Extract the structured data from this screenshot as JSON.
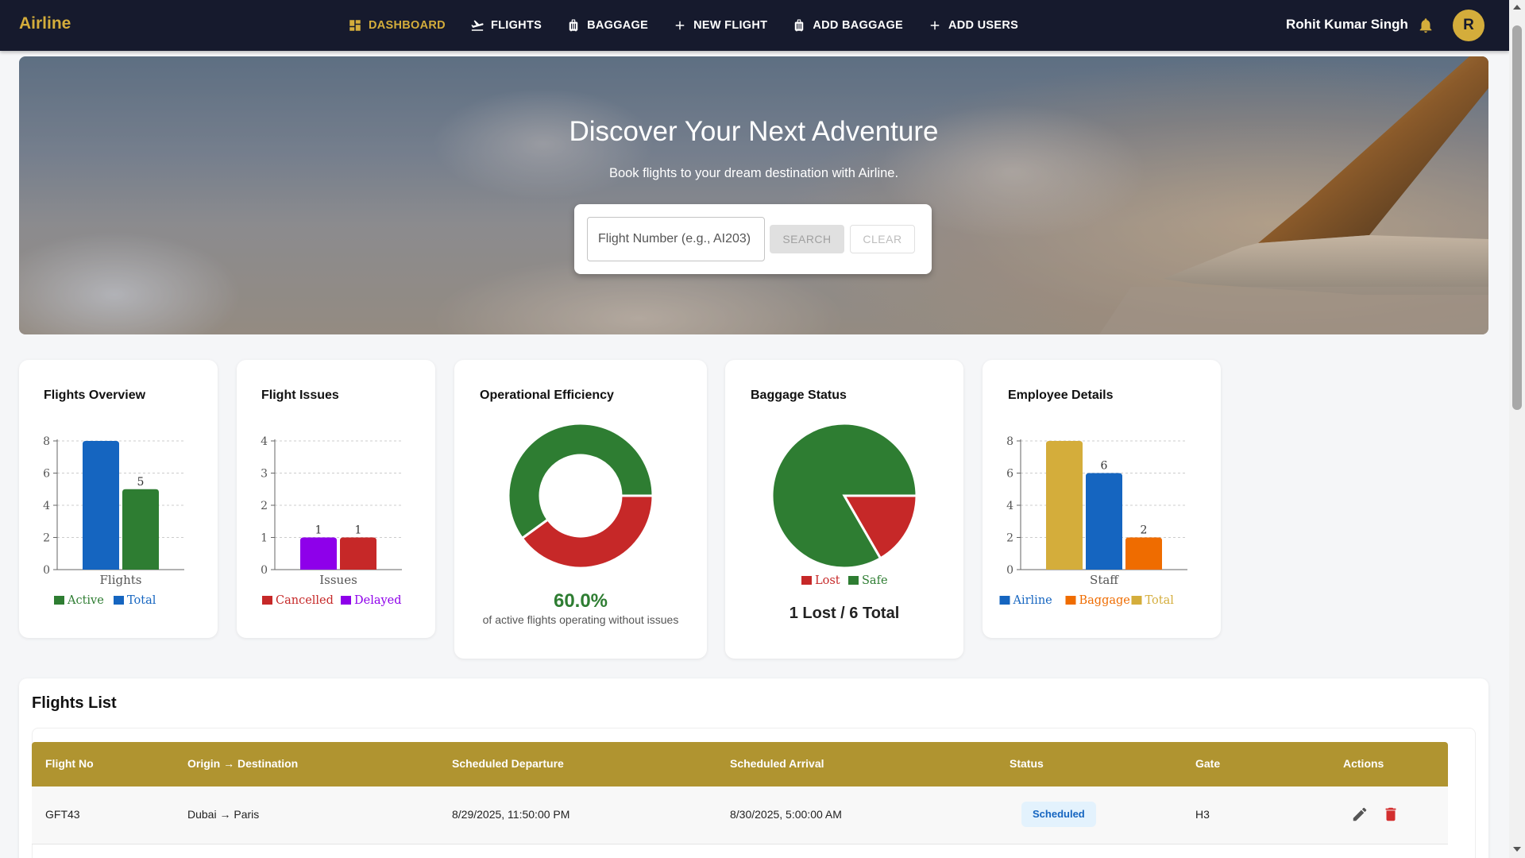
{
  "app": {
    "brand": "Airline"
  },
  "nav": {
    "items": [
      {
        "label": "DASHBOARD",
        "icon": "dashboard-icon",
        "active": true
      },
      {
        "label": "FLIGHTS",
        "icon": "flight-takeoff-icon"
      },
      {
        "label": "BAGGAGE",
        "icon": "luggage-icon"
      },
      {
        "label": "NEW FLIGHT",
        "icon": "plus-icon"
      },
      {
        "label": "ADD BAGGAGE",
        "icon": "luggage-icon"
      },
      {
        "label": "ADD USERS",
        "icon": "plus-icon"
      }
    ]
  },
  "user": {
    "name": "Rohit Kumar Singh",
    "avatar_initial": "R"
  },
  "colors": {
    "navbar": "#161a2d",
    "accent": "#d4ad3b",
    "table_header": "#b09430",
    "green": "#2e7d32",
    "red": "#c62828",
    "blue": "#1565c0",
    "purple": "#8e00ea",
    "orange": "#ef6c00"
  },
  "hero": {
    "title": "Discover Your Next Adventure",
    "subtitle": "Book flights to your dream destination with Airline.",
    "search_placeholder": "Flight Number (e.g., AI203)",
    "search_label": "SEARCH",
    "clear_label": "CLEAR"
  },
  "cards": {
    "flights_overview": {
      "title": "Flights Overview"
    },
    "flight_issues": {
      "title": "Flight Issues"
    },
    "operational_efficiency": {
      "title": "Operational Efficiency",
      "value": "60.0%",
      "subtitle": "of active flights operating without issues"
    },
    "baggage_status": {
      "title": "Baggage Status",
      "summary": "1 Lost / 6 Total"
    },
    "employee_details": {
      "title": "Employee Details"
    }
  },
  "chart_data": [
    {
      "id": "flights_overview",
      "type": "bar",
      "categories": [
        "Flights"
      ],
      "series": [
        {
          "name": "Total",
          "values": [
            8
          ],
          "color": "#1565c0"
        },
        {
          "name": "Active",
          "values": [
            5
          ],
          "color": "#2e7d32"
        }
      ],
      "data_labels": [
        "",
        "5"
      ],
      "ylim": [
        0,
        8
      ],
      "yticks": [
        0,
        2,
        4,
        6,
        8
      ],
      "legend": [
        {
          "name": "Active",
          "color": "#2e7d32"
        },
        {
          "name": "Total",
          "color": "#1565c0"
        }
      ]
    },
    {
      "id": "flight_issues",
      "type": "bar",
      "categories": [
        "Issues"
      ],
      "series": [
        {
          "name": "Delayed",
          "values": [
            1
          ],
          "color": "#8e00ea"
        },
        {
          "name": "Cancelled",
          "values": [
            1
          ],
          "color": "#c62828"
        }
      ],
      "data_labels": [
        "1",
        "1"
      ],
      "ylim": [
        0,
        4
      ],
      "yticks": [
        0,
        1,
        2,
        3,
        4
      ],
      "legend": [
        {
          "name": "Cancelled",
          "color": "#c62828"
        },
        {
          "name": "Delayed",
          "color": "#8e00ea"
        }
      ]
    },
    {
      "id": "operational_efficiency",
      "type": "pie",
      "donut": true,
      "slices": [
        {
          "name": "Operating without issues",
          "value": 60,
          "color": "#2e7d32"
        },
        {
          "name": "With issues",
          "value": 40,
          "color": "#c62828"
        }
      ]
    },
    {
      "id": "baggage_status",
      "type": "pie",
      "slices": [
        {
          "name": "Safe",
          "value": 5,
          "color": "#2e7d32"
        },
        {
          "name": "Lost",
          "value": 1,
          "color": "#c62828"
        }
      ],
      "legend": [
        {
          "name": "Lost",
          "color": "#c62828"
        },
        {
          "name": "Safe",
          "color": "#2e7d32"
        }
      ]
    },
    {
      "id": "employee_details",
      "type": "bar",
      "categories": [
        "Staff"
      ],
      "series": [
        {
          "name": "Total",
          "values": [
            8
          ],
          "color": "#d4ad3b"
        },
        {
          "name": "Airline",
          "values": [
            6
          ],
          "color": "#1565c0"
        },
        {
          "name": "Baggage",
          "values": [
            2
          ],
          "color": "#ef6c00"
        }
      ],
      "data_labels": [
        "",
        "6",
        "2"
      ],
      "ylim": [
        0,
        8
      ],
      "yticks": [
        0,
        2,
        4,
        6,
        8
      ],
      "legend": [
        {
          "name": "Airline",
          "color": "#1565c0"
        },
        {
          "name": "Baggage",
          "color": "#ef6c00"
        },
        {
          "name": "Total",
          "color": "#d4ad3b"
        }
      ]
    }
  ],
  "flights_list": {
    "title": "Flights List",
    "columns": [
      "Flight No",
      "Origin → Destination",
      "Scheduled Departure",
      "Scheduled Arrival",
      "Status",
      "Gate",
      "Actions"
    ],
    "rows": [
      {
        "flight_no": "GFT43",
        "route": "Dubai → Paris",
        "departure": "8/29/2025, 11:50:00 PM",
        "arrival": "8/30/2025, 5:00:00 AM",
        "status": "Scheduled",
        "gate": "H3"
      }
    ]
  }
}
